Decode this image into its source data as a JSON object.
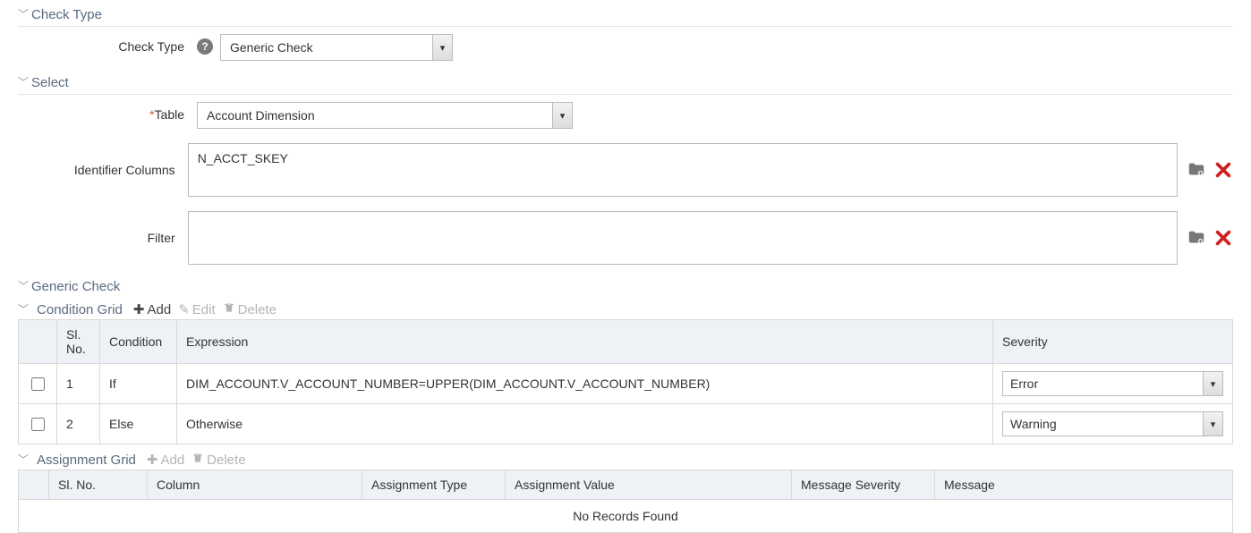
{
  "sections": {
    "check_type_title": "Check Type",
    "select_title": "Select",
    "generic_check_title": "Generic Check",
    "condition_grid_title": "Condition Grid",
    "assignment_grid_title": "Assignment Grid"
  },
  "check_type": {
    "label": "Check Type",
    "value": "Generic Check"
  },
  "select": {
    "table_label": "Table",
    "table_value": "Account Dimension",
    "identifier_label": "Identifier Columns",
    "identifier_value": "N_ACCT_SKEY",
    "filter_label": "Filter",
    "filter_value": ""
  },
  "toolbar": {
    "add": "Add",
    "edit": "Edit",
    "delete": "Delete"
  },
  "condition_grid": {
    "headers": {
      "sl": "Sl. No.",
      "condition": "Condition",
      "expression": "Expression",
      "severity": "Severity"
    },
    "rows": [
      {
        "sl": "1",
        "condition": "If",
        "expression": "DIM_ACCOUNT.V_ACCOUNT_NUMBER=UPPER(DIM_ACCOUNT.V_ACCOUNT_NUMBER)",
        "severity": "Error"
      },
      {
        "sl": "2",
        "condition": "Else",
        "expression": "Otherwise",
        "severity": "Warning"
      }
    ]
  },
  "assignment_grid": {
    "headers": {
      "sl": "Sl. No.",
      "column": "Column",
      "assignment_type": "Assignment Type",
      "assignment_value": "Assignment Value",
      "message_severity": "Message Severity",
      "message": "Message"
    },
    "no_records": "No Records Found"
  }
}
